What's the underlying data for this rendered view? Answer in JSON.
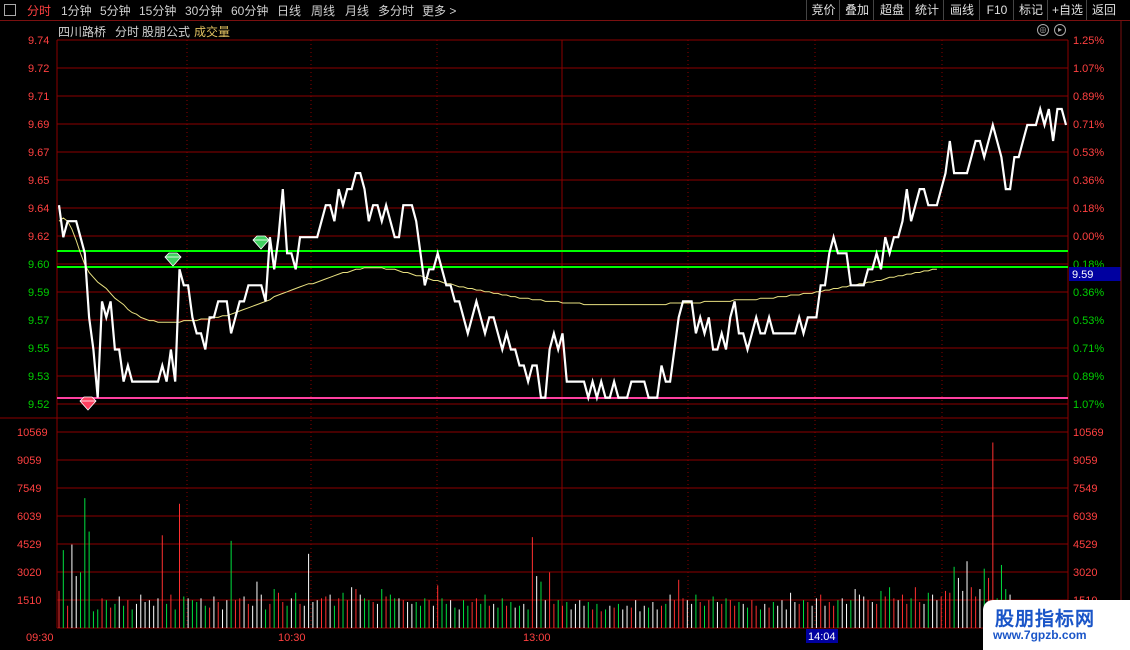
{
  "toolbar": {
    "tabs": [
      "分时",
      "1分钟",
      "5分钟",
      "15分钟",
      "30分钟",
      "60分钟",
      "日线",
      "周线",
      "月线",
      "多分时",
      "更多 >"
    ],
    "right_buttons": [
      "竞价",
      "叠加",
      "超盘",
      "统计",
      "画线",
      "F10",
      "标记",
      "+自选",
      "返回"
    ]
  },
  "subtitle": {
    "stock": "四川路桥",
    "mode": "分时",
    "formula": "股朋公式",
    "indicator": "成交量"
  },
  "logo": {
    "title": "股朋指标网",
    "url": "www.7gpzb.com"
  },
  "colors": {
    "price_line": "#ffffff",
    "avg_line": "#e8e080",
    "green_line": "#00ff00",
    "magenta_line": "#ff40a0",
    "grid": "#8b0000",
    "up": "#ff3030",
    "down": "#00e040",
    "axis_text_red": "#ff4040",
    "axis_text_green": "#00d000"
  },
  "chart_data": {
    "type": "line",
    "price_ylabels": [
      "9.74",
      "9.72",
      "9.71",
      "9.69",
      "9.67",
      "9.65",
      "9.64",
      "9.62",
      "9.60",
      "9.59",
      "9.57",
      "9.55",
      "9.53",
      "9.52"
    ],
    "pct_ylabels": [
      "1.25%",
      "1.07%",
      "0.89%",
      "0.71%",
      "0.53%",
      "0.36%",
      "0.18%",
      "0.00%",
      "0.18%",
      "0.36%",
      "0.53%",
      "0.71%",
      "0.89%",
      "1.07%"
    ],
    "volume_ylabels": [
      "10569",
      "9059",
      "7549",
      "6039",
      "4529",
      "3020",
      "1510"
    ],
    "x_ticks": [
      "09:30",
      "10:30",
      "13:00"
    ],
    "x_cursor_label": "14:04",
    "price_cursor_label": "9.59",
    "ylim": [
      9.516,
      9.743
    ],
    "reference_price": 9.62,
    "horizontal_lines": {
      "green_upper": 9.61,
      "green_lower": 9.6,
      "magenta": 9.52
    },
    "price": [
      9.64,
      9.62,
      9.63,
      9.63,
      9.63,
      9.62,
      9.61,
      9.57,
      9.55,
      9.52,
      9.58,
      9.57,
      9.58,
      9.55,
      9.55,
      9.53,
      9.54,
      9.53,
      9.53,
      9.53,
      9.53,
      9.53,
      9.53,
      9.53,
      9.54,
      9.53,
      9.55,
      9.53,
      9.6,
      9.59,
      9.59,
      9.57,
      9.56,
      9.56,
      9.55,
      9.57,
      9.57,
      9.58,
      9.58,
      9.58,
      9.56,
      9.57,
      9.58,
      9.58,
      9.59,
      9.59,
      9.59,
      9.59,
      9.58,
      9.62,
      9.6,
      9.62,
      9.65,
      9.61,
      9.61,
      9.6,
      9.62,
      9.62,
      9.62,
      9.62,
      9.62,
      9.63,
      9.64,
      9.64,
      9.63,
      9.65,
      9.64,
      9.65,
      9.65,
      9.66,
      9.66,
      9.65,
      9.63,
      9.64,
      9.64,
      9.63,
      9.64,
      9.63,
      9.62,
      9.62,
      9.64,
      9.64,
      9.64,
      9.63,
      9.61,
      9.59,
      9.6,
      9.6,
      9.61,
      9.6,
      9.59,
      9.59,
      9.58,
      9.58,
      9.57,
      9.56,
      9.57,
      9.58,
      9.57,
      9.56,
      9.57,
      9.57,
      9.56,
      9.55,
      9.56,
      9.55,
      9.55,
      9.54,
      9.54,
      9.53,
      9.54,
      9.54,
      9.52,
      9.52,
      9.55,
      9.56,
      9.55,
      9.56,
      9.53,
      9.53,
      9.53,
      9.53,
      9.53,
      9.52,
      9.53,
      9.52,
      9.53,
      9.52,
      9.52,
      9.53,
      9.52,
      9.52,
      9.52,
      9.53,
      9.53,
      9.53,
      9.53,
      9.52,
      9.52,
      9.52,
      9.54,
      9.53,
      9.53,
      9.55,
      9.57,
      9.58,
      9.58,
      9.58,
      9.56,
      9.57,
      9.56,
      9.57,
      9.55,
      9.55,
      9.56,
      9.55,
      9.57,
      9.58,
      9.56,
      9.56,
      9.55,
      9.56,
      9.57,
      9.56,
      9.56,
      9.57,
      9.56,
      9.56,
      9.56,
      9.56,
      9.56,
      9.56,
      9.57,
      9.56,
      9.57,
      9.57,
      9.57,
      9.59,
      9.59,
      9.61,
      9.62,
      9.61,
      9.61,
      9.61,
      9.59,
      9.59,
      9.59,
      9.59,
      9.6,
      9.6,
      9.61,
      9.6,
      9.62,
      9.61,
      9.62,
      9.62,
      9.63,
      9.65,
      9.63,
      9.64,
      9.65,
      9.65,
      9.64,
      9.64,
      9.64,
      9.65,
      9.66,
      9.68,
      9.66,
      9.66,
      9.66,
      9.66,
      9.67,
      9.68,
      9.68,
      9.67,
      9.68,
      9.69,
      9.68,
      9.67,
      9.65,
      9.65,
      9.67,
      9.67,
      9.68,
      9.69,
      9.69,
      9.69,
      9.7,
      9.69,
      9.7,
      9.68,
      9.7,
      9.7,
      9.69
    ],
    "avg": [
      9.63,
      9.632,
      9.63,
      9.625,
      9.618,
      9.61,
      9.603,
      9.598,
      9.595,
      9.592,
      9.59,
      9.588,
      9.585,
      9.582,
      9.58,
      9.578,
      9.575,
      9.573,
      9.572,
      9.57,
      9.569,
      9.568,
      9.568,
      9.567,
      9.567,
      9.567,
      9.567,
      9.567,
      9.567,
      9.568,
      9.568,
      9.568,
      9.568,
      9.569,
      9.569,
      9.569,
      9.57,
      9.57,
      9.571,
      9.571,
      9.572,
      9.573,
      9.574,
      9.575,
      9.576,
      9.577,
      9.578,
      9.579,
      9.58,
      9.581,
      9.583,
      9.584,
      9.585,
      9.586,
      9.587,
      9.588,
      9.589,
      9.59,
      9.591,
      9.591,
      9.592,
      9.593,
      9.594,
      9.595,
      9.596,
      9.597,
      9.598,
      9.598,
      9.599,
      9.6,
      9.6,
      9.601,
      9.601,
      9.601,
      9.601,
      9.601,
      9.6,
      9.6,
      9.6,
      9.599,
      9.598,
      9.598,
      9.597,
      9.596,
      9.596,
      9.595,
      9.594,
      9.593,
      9.593,
      9.592,
      9.591,
      9.591,
      9.59,
      9.589,
      9.589,
      9.588,
      9.588,
      9.587,
      9.587,
      9.586,
      9.586,
      9.585,
      9.585,
      9.584,
      9.584,
      9.583,
      9.583,
      9.582,
      9.582,
      9.582,
      9.581,
      9.581,
      9.581,
      9.58,
      9.58,
      9.58,
      9.58,
      9.579,
      9.579,
      9.579,
      9.579,
      9.579,
      9.578,
      9.578,
      9.578,
      9.578,
      9.578,
      9.578,
      9.578,
      9.578,
      9.578,
      9.578,
      9.578,
      9.578,
      9.578,
      9.578,
      9.578,
      9.578,
      9.578,
      9.578,
      9.578,
      9.578,
      9.579,
      9.579,
      9.579,
      9.579,
      9.579,
      9.579,
      9.579,
      9.579,
      9.58,
      9.58,
      9.58,
      9.58,
      9.58,
      9.58,
      9.58,
      9.581,
      9.581,
      9.581,
      9.581,
      9.581,
      9.581,
      9.582,
      9.582,
      9.582,
      9.582,
      9.583,
      9.583,
      9.583,
      9.584,
      9.584,
      9.584,
      9.585,
      9.585,
      9.585,
      9.586,
      9.586,
      9.587,
      9.587,
      9.588,
      9.588,
      9.589,
      9.589,
      9.59,
      9.59,
      9.591,
      9.591,
      9.592,
      9.592,
      9.593,
      9.593,
      9.594,
      9.595,
      9.595,
      9.596,
      9.596,
      9.597,
      9.597,
      9.598,
      9.598,
      9.599,
      9.599,
      9.6,
      9.6
    ],
    "volume": [
      2000,
      4200,
      1200,
      4500,
      2800,
      3000,
      7000,
      5200,
      900,
      1000,
      1600,
      1500,
      1100,
      1300,
      1700,
      1200,
      1500,
      1000,
      1300,
      1800,
      1400,
      1500,
      1200,
      1600,
      5000,
      1300,
      1800,
      1000,
      6700,
      1700,
      1600,
      1500,
      1400,
      1600,
      1200,
      1100,
      1700,
      1400,
      1000,
      1500,
      4700,
      1500,
      1600,
      1700,
      1300,
      1200,
      2500,
      1800,
      1000,
      1300,
      2100,
      1900,
      1400,
      1200,
      1600,
      1900,
      1300,
      1200,
      4000,
      1400,
      1500,
      1600,
      1700,
      1800,
      1200,
      1600,
      1900,
      1500,
      2200,
      2100,
      1800,
      1600,
      1500,
      1400,
      1300,
      2100,
      1700,
      1800,
      1600,
      1600,
      1500,
      1400,
      1300,
      1400,
      1200,
      1600,
      1500,
      1200,
      2300,
      1600,
      1300,
      1500,
      1100,
      1000,
      1500,
      1200,
      1400,
      1600,
      1300,
      1800,
      1200,
      1300,
      1100,
      1600,
      1200,
      1400,
      1100,
      1200,
      1300,
      1000,
      4900,
      2800,
      2500,
      1500,
      3000,
      1300,
      1500,
      1200,
      1400,
      1000,
      1300,
      1500,
      1200,
      1400,
      1000,
      1300,
      900,
      1000,
      1200,
      1100,
      1300,
      1000,
      1200,
      1100,
      1500,
      900,
      1200,
      1100,
      1400,
      1000,
      1200,
      1300,
      1800,
      1500,
      2600,
      1600,
      1500,
      1300,
      1800,
      1400,
      1200,
      1500,
      1700,
      1400,
      1300,
      1600,
      1500,
      1200,
      1400,
      1300,
      1100,
      1500,
      1200,
      1000,
      1300,
      1100,
      1400,
      1200,
      1500,
      1000,
      1900,
      1400,
      1300,
      1500,
      1400,
      1200,
      1600,
      1800,
      1200,
      1400,
      1200,
      1500,
      1600,
      1300,
      1500,
      2100,
      1800,
      1700,
      1500,
      1400,
      1300,
      2000,
      1700,
      2200,
      1600,
      1500,
      1800,
      1300,
      1600,
      2200,
      1400,
      1300,
      1900,
      1800,
      1500,
      1700,
      2000,
      1900,
      3300,
      2700,
      2000,
      3600,
      2200,
      1700,
      2100,
      3200,
      2700,
      10000,
      1600,
      3400,
      2100,
      1800,
      1400,
      1500
    ]
  }
}
